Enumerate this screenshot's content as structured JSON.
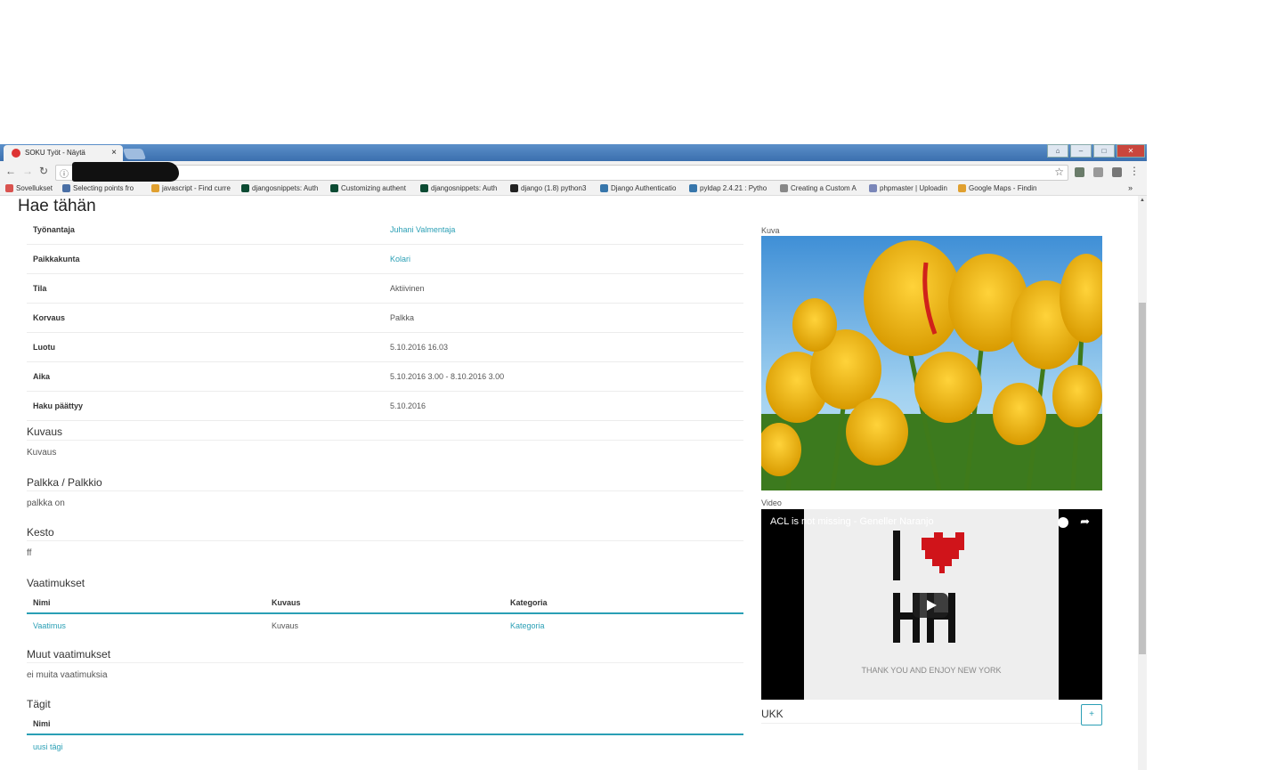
{
  "browser": {
    "tab_title": "SOKU Työt - Näytä",
    "tab_close": "×",
    "bookmarks": [
      {
        "label": "Sovellukset",
        "color": "#d9534f"
      },
      {
        "label": "Selecting points fro",
        "color": "#4a6fa5"
      },
      {
        "label": "javascript - Find curre",
        "color": "#e0a030"
      },
      {
        "label": "djangosnippets: Auth",
        "color": "#0c4b33"
      },
      {
        "label": "Customizing authent",
        "color": "#0c4b33"
      },
      {
        "label": "djangosnippets: Auth",
        "color": "#0c4b33"
      },
      {
        "label": "django (1.8) python3",
        "color": "#222222"
      },
      {
        "label": "Django Authenticatio",
        "color": "#3776ab"
      },
      {
        "label": "pyldap 2.4.21 : Pytho",
        "color": "#3776ab"
      },
      {
        "label": "Creating a Custom A",
        "color": "#888888"
      },
      {
        "label": "phpmaster | Uploadin",
        "color": "#7a86b8"
      },
      {
        "label": "Google Maps - Findin",
        "color": "#e0a030"
      }
    ],
    "bookmarks_more": "»"
  },
  "page": {
    "title": "Hae tähän",
    "details": [
      {
        "key": "Työnantaja",
        "value": "Juhani Valmentaja",
        "link": true
      },
      {
        "key": "Paikkakunta",
        "value": "Kolari",
        "link": true
      },
      {
        "key": "Tila",
        "value": "Aktiivinen",
        "link": false
      },
      {
        "key": "Korvaus",
        "value": "Palkka",
        "link": false
      },
      {
        "key": "Luotu",
        "value": "5.10.2016 16.03",
        "link": false
      },
      {
        "key": "Aika",
        "value": "5.10.2016 3.00 - 8.10.2016 3.00",
        "link": false
      },
      {
        "key": "Haku päättyy",
        "value": "5.10.2016",
        "link": false
      }
    ],
    "kuvaus": {
      "heading": "Kuvaus",
      "text": "Kuvaus"
    },
    "palkka": {
      "heading": "Palkka / Palkkio",
      "text": "palkka on"
    },
    "kesto": {
      "heading": "Kesto",
      "text": "ff"
    },
    "vaatimukset": {
      "heading": "Vaatimukset",
      "columns": [
        "Nimi",
        "Kuvaus",
        "Kategoria"
      ],
      "rows": [
        [
          "Vaatimus",
          "Kuvaus",
          "Kategoria"
        ]
      ]
    },
    "muut": {
      "heading": "Muut vaatimukset",
      "text": "ei muita vaatimuksia"
    },
    "tagit": {
      "heading": "Tägit",
      "column": "Nimi",
      "row": "uusi tägi"
    },
    "side": {
      "kuva_label": "Kuva",
      "video_label": "Video",
      "video_title": "ACL is not missing - Geneller Naranjo",
      "video_caption": "THANK YOU AND ENJOY NEW YORK",
      "ukk_heading": "UKK",
      "ukk_add": "+"
    }
  },
  "colors": {
    "accent": "#2a9fb5"
  }
}
